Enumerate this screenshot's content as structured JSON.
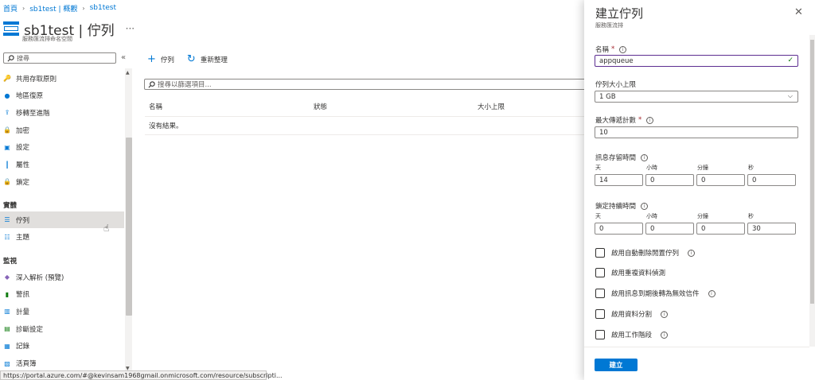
{
  "breadcrumb": [
    "首頁",
    "sb1test | 概觀",
    "sb1test"
  ],
  "header": {
    "title": "sb1test | 佇列",
    "subtitle": "服務匯流排命名空間",
    "more": "···"
  },
  "sidebar": {
    "search_placeholder": "搜尋",
    "collapse": "«",
    "items_top": [
      {
        "label": "共用存取原則",
        "icon": "key-icon",
        "color": "#ffb900"
      },
      {
        "label": "地區復原",
        "icon": "globe-icon",
        "color": "#0078d4"
      },
      {
        "label": "移轉至進階",
        "icon": "migrate-icon",
        "color": "#0078d4"
      },
      {
        "label": "加密",
        "icon": "lock-icon",
        "color": "#0078d4"
      },
      {
        "label": "設定",
        "icon": "settings-icon",
        "color": "#0078d4"
      },
      {
        "label": "屬性",
        "icon": "properties-icon",
        "color": "#0078d4"
      },
      {
        "label": "鎖定",
        "icon": "lock-icon",
        "color": "#0078d4"
      }
    ],
    "section_entities": "實體",
    "items_entities": [
      {
        "label": "佇列",
        "icon": "queue-icon",
        "color": "#0078d4",
        "active": true
      },
      {
        "label": "主題",
        "icon": "topic-icon",
        "color": "#0078d4"
      }
    ],
    "section_monitoring": "監視",
    "items_monitoring": [
      {
        "label": "深入解析 (預覽)",
        "icon": "insights-icon",
        "color": "#8764b8"
      },
      {
        "label": "警訊",
        "icon": "alert-icon",
        "color": "#107c10"
      },
      {
        "label": "計量",
        "icon": "metrics-icon",
        "color": "#0078d4"
      },
      {
        "label": "診斷設定",
        "icon": "diagnostics-icon",
        "color": "#107c10"
      },
      {
        "label": "記錄",
        "icon": "logs-icon",
        "color": "#0078d4"
      },
      {
        "label": "活頁簿",
        "icon": "workbook-icon",
        "color": "#0078d4"
      }
    ]
  },
  "status_url": "https://portal.azure.com/#@kevinsam1968gmail.onmicrosoft.com/resource/subscripti...",
  "toolbar": {
    "add_label": "佇列",
    "refresh_label": "重新整理"
  },
  "filter_placeholder": "搜尋以篩選項目...",
  "table": {
    "columns": [
      "名稱",
      "狀態",
      "大小上限"
    ],
    "empty_text": "沒有結果。"
  },
  "blade": {
    "title": "建立佇列",
    "subtitle": "服務匯流排",
    "close": "✕",
    "name_label": "名稱",
    "name_value": "appqueue",
    "max_size_label": "佇列大小上限",
    "max_size_value": "1 GB",
    "max_delivery_label": "最大傳遞計數",
    "max_delivery_value": "10",
    "ttl_label": "訊息存留時間",
    "lock_label": "鎖定持續時間",
    "units": [
      "天",
      "小時",
      "分鐘",
      "秒"
    ],
    "ttl_values": [
      "14",
      "0",
      "0",
      "0"
    ],
    "lock_values": [
      "0",
      "0",
      "0",
      "30"
    ],
    "checkboxes": [
      {
        "label": "啟用自動刪除閒置佇列",
        "checked": false
      },
      {
        "label": "啟用重複資料偵測",
        "checked": false
      },
      {
        "label": "啟用訊息到期後轉為無效信件",
        "checked": false
      },
      {
        "label": "啟用資料分割",
        "checked": false
      },
      {
        "label": "啟用工作階段",
        "checked": false
      }
    ],
    "create_label": "建立",
    "required_mark": "*",
    "info_glyph": "i"
  }
}
